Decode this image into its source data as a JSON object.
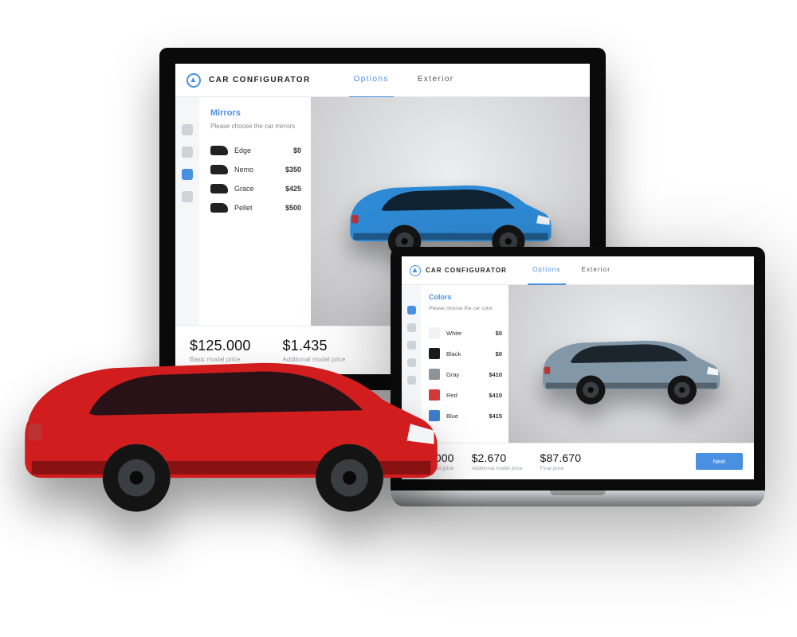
{
  "appTitle": "CAR CONFIGURATOR",
  "tabs": {
    "options": "Options",
    "exterior": "Exterior"
  },
  "monitor": {
    "panelTitle": "Mirrors",
    "panelHint": "Please choose the car mirrors",
    "options": [
      {
        "name": "Edge",
        "price": "$0"
      },
      {
        "name": "Nemo",
        "price": "$350"
      },
      {
        "name": "Grace",
        "price": "$425"
      },
      {
        "name": "Pellet",
        "price": "$500"
      }
    ],
    "carColor": "#2f8bd6",
    "prices": {
      "basic": {
        "amount": "$125.000",
        "label": "Basic model price"
      },
      "additional": {
        "amount": "$1.435",
        "label": "Additional model price"
      }
    }
  },
  "laptop": {
    "panelTitle": "Colors",
    "panelHint": "Please choose the car color",
    "options": [
      {
        "name": "White",
        "price": "$0",
        "color": "#f2f2f2"
      },
      {
        "name": "Black",
        "price": "$0",
        "color": "#1a1a1a"
      },
      {
        "name": "Gray",
        "price": "$410",
        "color": "#8e9399"
      },
      {
        "name": "Red",
        "price": "$410",
        "color": "#d23a3a"
      },
      {
        "name": "Blue",
        "price": "$415",
        "color": "#3d7ecb"
      }
    ],
    "carColor": "#8298a8",
    "prices": {
      "basic": {
        "amount": "$85.000",
        "label": "Basic model price"
      },
      "additional": {
        "amount": "$2.670",
        "label": "Additional model price"
      },
      "final": {
        "amount": "$87.670",
        "label": "Final price"
      }
    },
    "nextLabel": "Next"
  },
  "heroCarColor": "#d11d1d"
}
